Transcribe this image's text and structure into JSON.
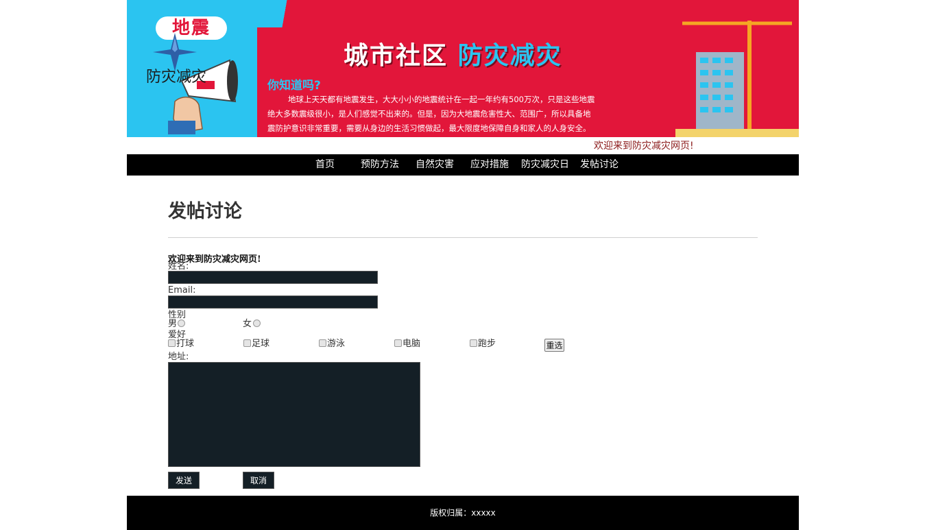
{
  "banner": {
    "badge": "地震",
    "logo_text": "防灾减灾",
    "title_main": "城市社区",
    "title_accent": "防灾减灾",
    "question": "你知道吗?",
    "body_line1": "地球上天天都有地震发生，大大小小的地震统计在一起一年约有500万次，只是这些地震",
    "body_line2": "绝大多数震级很小，是人们感觉不出来的。但是，因为大地震危害性大、范围广，所以具备地",
    "body_line3": "震防护意识非常重要，需要从身边的生活习惯做起，最大限度地保障自身和家人的人身安全。"
  },
  "welcome_top": "欢迎来到防灾减灾网页!",
  "nav": {
    "items": [
      {
        "label": "首页"
      },
      {
        "label": "预防方法"
      },
      {
        "label": "自然灾害"
      },
      {
        "label": "应对措施"
      },
      {
        "label": "防灾减灾日"
      },
      {
        "label": "发帖讨论"
      }
    ]
  },
  "page_title": "发帖讨论",
  "form": {
    "welcome": "欢迎来到防灾减灾网页!",
    "name_label": "姓名:",
    "name_value": "",
    "email_label": "Email:",
    "email_value": "",
    "gender_label": "性别",
    "gender_options": [
      "男",
      "女"
    ],
    "hobby_label": "爱好",
    "hobbies": [
      "打球",
      "足球",
      "游泳",
      "电脑",
      "跑步"
    ],
    "reset_label": "重选",
    "address_label": "地址:",
    "address_value": "",
    "submit_label": "发送",
    "cancel_label": "取消"
  },
  "footer": {
    "copyright": "版权归属：xxxxx"
  },
  "colors": {
    "nav_bg": "#000000",
    "input_bg": "#141f26",
    "banner_red": "#e2163a",
    "banner_blue": "#2bc4f0"
  }
}
